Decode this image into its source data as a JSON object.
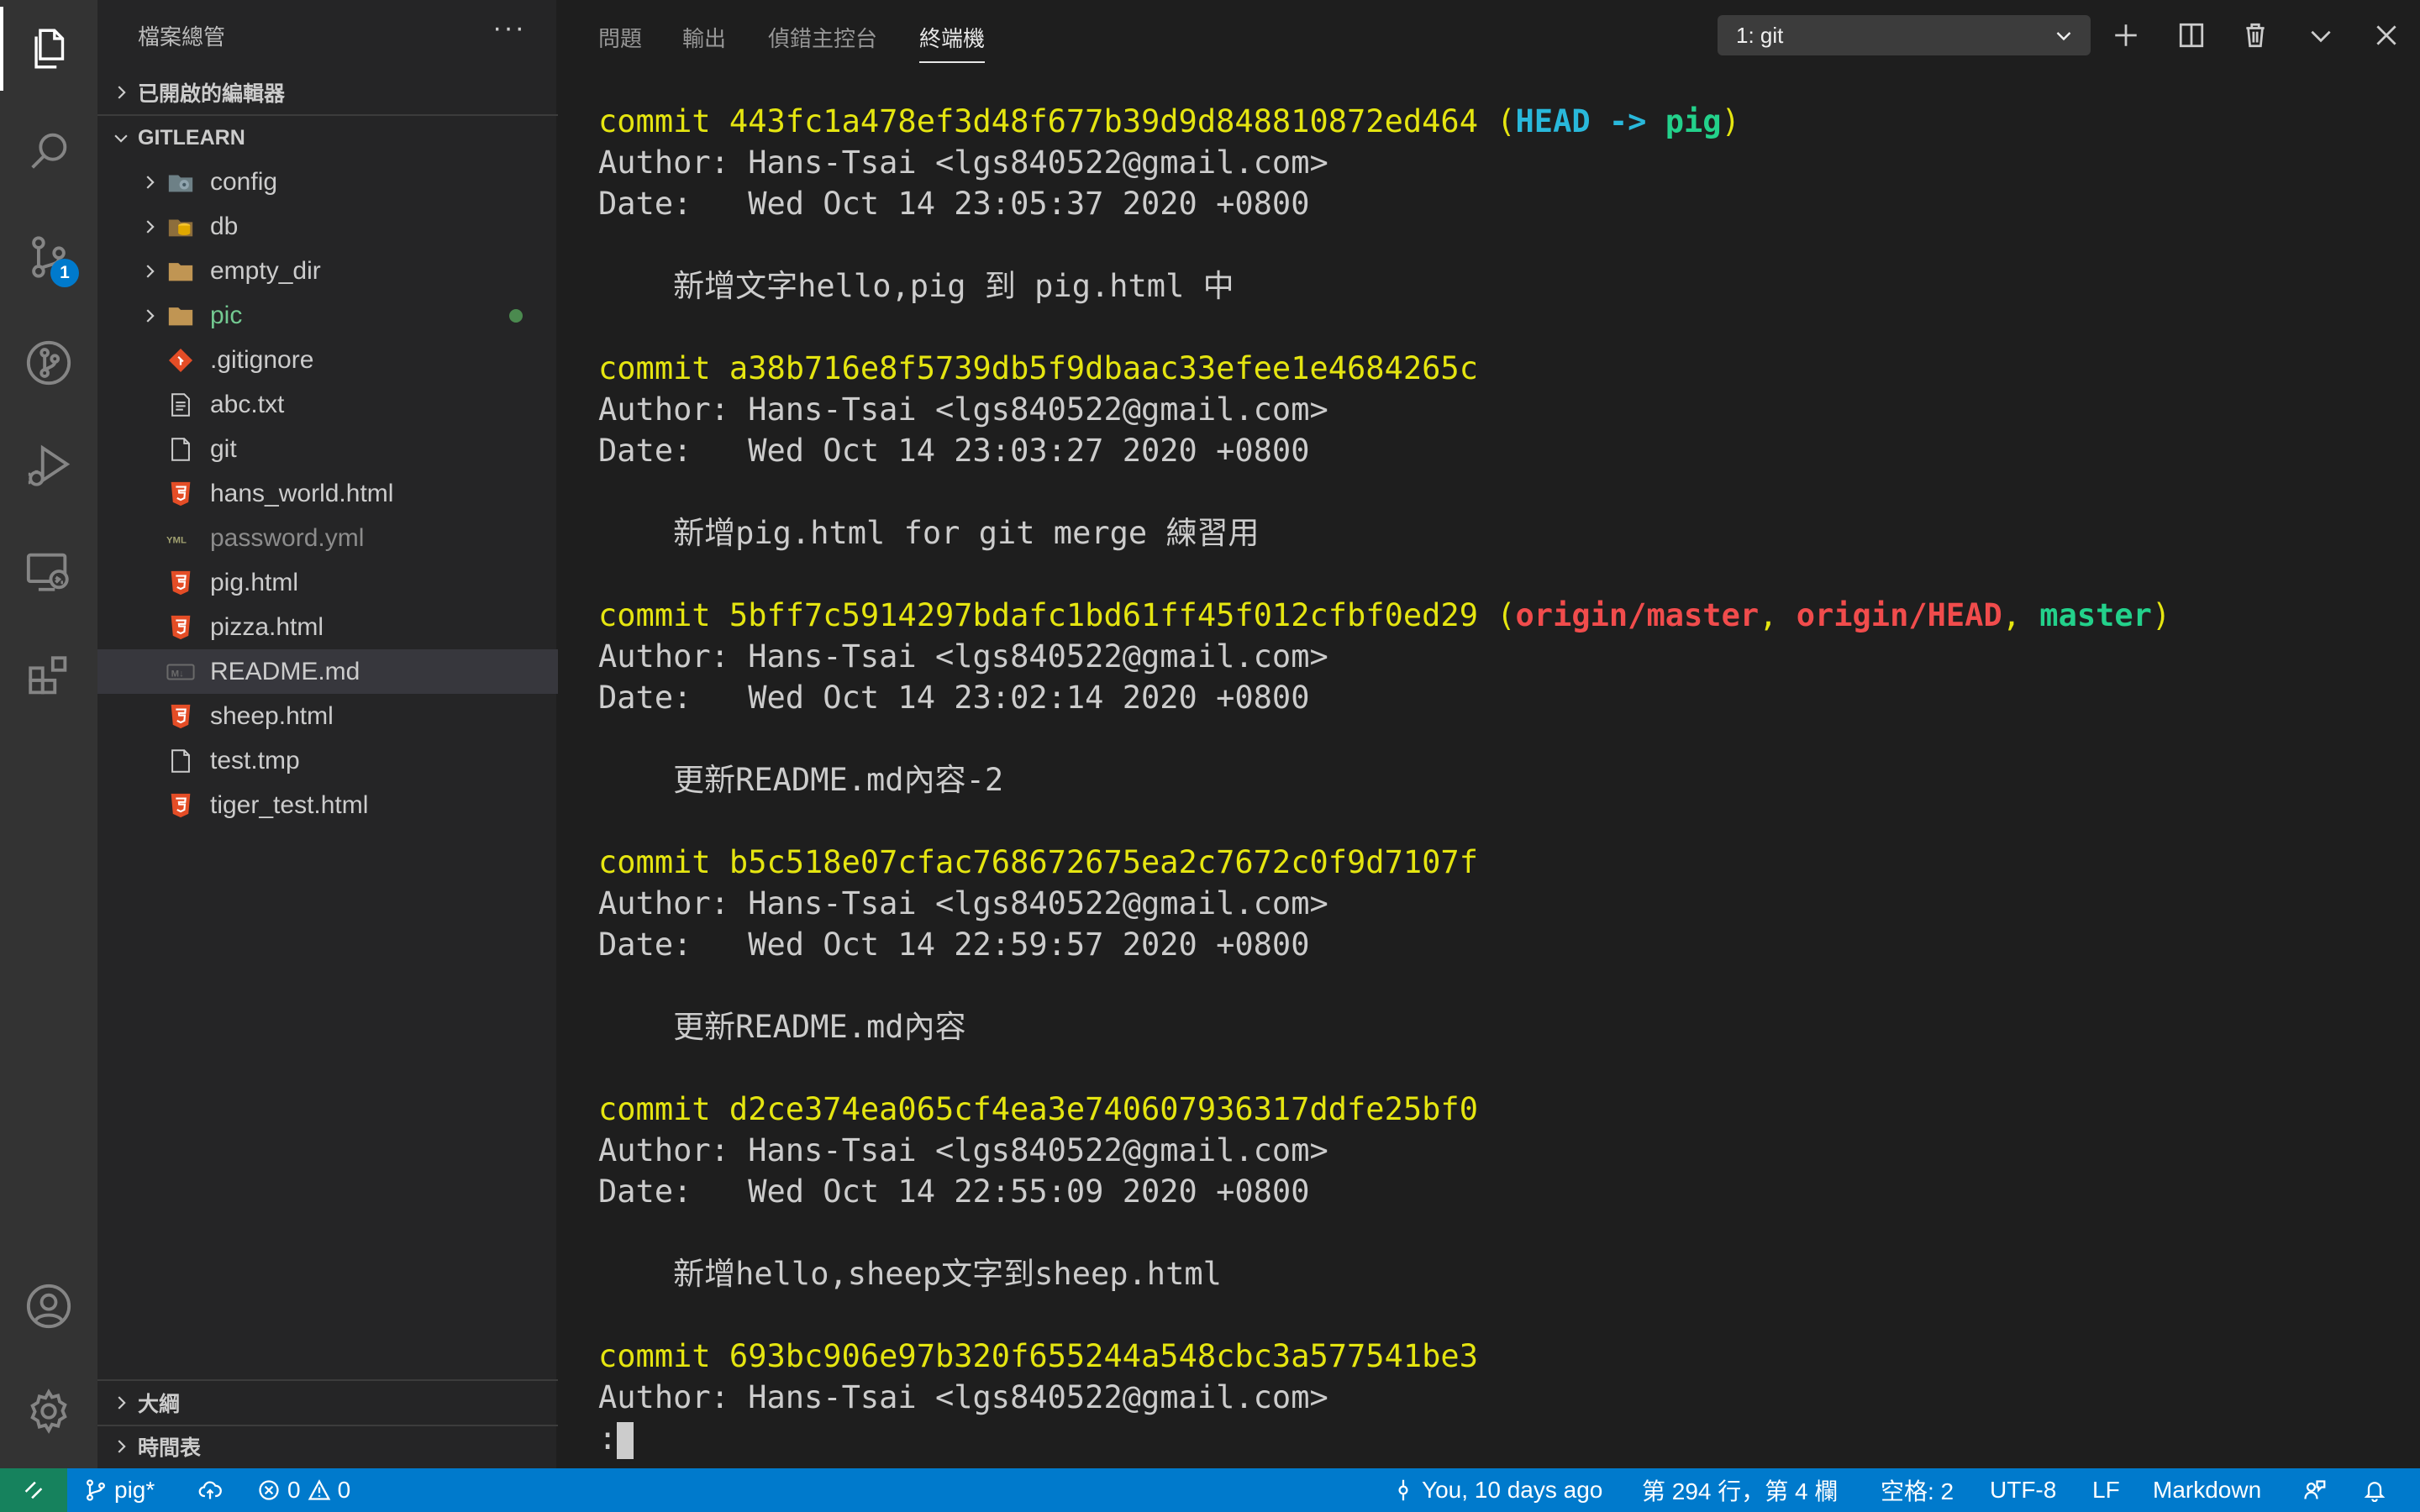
{
  "activity_bar": {
    "items": [
      {
        "icon": "files-icon",
        "active": true
      },
      {
        "icon": "search-icon"
      },
      {
        "icon": "source-control-icon",
        "badge": "1"
      },
      {
        "icon": "git-graph-icon"
      },
      {
        "icon": "run-debug-icon"
      },
      {
        "icon": "remote-explorer-icon"
      },
      {
        "icon": "extensions-icon"
      }
    ],
    "bottom_items": [
      {
        "icon": "account-icon"
      },
      {
        "icon": "settings-gear-icon"
      }
    ]
  },
  "sidebar": {
    "title": "檔案總管",
    "more_label": "···",
    "open_editors_label": "已開啟的編輯器",
    "folder_label": "GITLEARN",
    "files": [
      {
        "name": "config",
        "type": "folder",
        "icon": "config-folder-icon"
      },
      {
        "name": "db",
        "type": "folder",
        "icon": "database-folder-icon"
      },
      {
        "name": "empty_dir",
        "type": "folder",
        "icon": "folder-icon"
      },
      {
        "name": "pic",
        "type": "folder",
        "icon": "folder-icon",
        "modified": true
      },
      {
        "name": ".gitignore",
        "type": "file",
        "icon": "git-icon"
      },
      {
        "name": "abc.txt",
        "type": "file",
        "icon": "text-file-icon"
      },
      {
        "name": "git",
        "type": "file",
        "icon": "blank-file-icon"
      },
      {
        "name": "hans_world.html",
        "type": "file",
        "icon": "html5-icon"
      },
      {
        "name": "password.yml",
        "type": "file",
        "icon": "yaml-icon",
        "ignored": true
      },
      {
        "name": "pig.html",
        "type": "file",
        "icon": "html5-icon"
      },
      {
        "name": "pizza.html",
        "type": "file",
        "icon": "html5-icon"
      },
      {
        "name": "README.md",
        "type": "file",
        "icon": "markdown-icon",
        "selected": true
      },
      {
        "name": "sheep.html",
        "type": "file",
        "icon": "html5-icon"
      },
      {
        "name": "test.tmp",
        "type": "file",
        "icon": "blank-file-icon"
      },
      {
        "name": "tiger_test.html",
        "type": "file",
        "icon": "html5-icon"
      }
    ],
    "outline_label": "大綱",
    "timeline_label": "時間表"
  },
  "panel": {
    "tabs": [
      "問題",
      "輸出",
      "偵錯主控台",
      "終端機"
    ],
    "active_tab": "終端機",
    "terminal_select": "1: git"
  },
  "terminal": {
    "commits": [
      {
        "hash": "commit 443fc1a478ef3d48f677b39d9d848810872ed464",
        "refs": [
          {
            "text": "HEAD -> ",
            "color": "cyan"
          },
          {
            "text": "pig",
            "color": "green"
          }
        ],
        "author": "Author: Hans-Tsai <lgs840522@gmail.com>",
        "date": "Date:   Wed Oct 14 23:05:37 2020 +0800",
        "message": "    新增文字hello,pig 到 pig.html 中"
      },
      {
        "hash": "commit a38b716e8f5739db5f9dbaac33efee1e4684265c",
        "refs": [],
        "author": "Author: Hans-Tsai <lgs840522@gmail.com>",
        "date": "Date:   Wed Oct 14 23:03:27 2020 +0800",
        "message": "    新增pig.html for git merge 練習用"
      },
      {
        "hash": "commit 5bff7c5914297bdafc1bd61ff45f012cfbf0ed29",
        "refs": [
          {
            "text": "origin/master",
            "color": "red"
          },
          {
            "text": ", ",
            "color": "yellow"
          },
          {
            "text": "origin/HEAD",
            "color": "red"
          },
          {
            "text": ", ",
            "color": "yellow"
          },
          {
            "text": "master",
            "color": "green"
          }
        ],
        "author": "Author: Hans-Tsai <lgs840522@gmail.com>",
        "date": "Date:   Wed Oct 14 23:02:14 2020 +0800",
        "message": "    更新README.md內容-2"
      },
      {
        "hash": "commit b5c518e07cfac768672675ea2c7672c0f9d7107f",
        "refs": [],
        "author": "Author: Hans-Tsai <lgs840522@gmail.com>",
        "date": "Date:   Wed Oct 14 22:59:57 2020 +0800",
        "message": "    更新README.md內容"
      },
      {
        "hash": "commit d2ce374ea065cf4ea3e740607936317ddfe25bf0",
        "refs": [],
        "author": "Author: Hans-Tsai <lgs840522@gmail.com>",
        "date": "Date:   Wed Oct 14 22:55:09 2020 +0800",
        "message": "    新增hello,sheep文字到sheep.html"
      },
      {
        "hash": "commit 693bc906e97b320f655244a548cbc3a577541be3",
        "refs": [],
        "author": "Author: Hans-Tsai <lgs840522@gmail.com>",
        "date": null,
        "message": null
      }
    ],
    "prompt": ":"
  },
  "status_bar": {
    "branch": "pig*",
    "errors": "0",
    "warnings": "0",
    "blame": "You, 10 days ago",
    "position": "第 294 行，第 4 欄",
    "spaces": "空格: 2",
    "encoding": "UTF-8",
    "eol": "LF",
    "language": "Markdown"
  },
  "colors": {
    "accent": "#007acc",
    "remote": "#16825d",
    "terminal_yellow": "#e5e510",
    "terminal_cyan": "#29b8db",
    "terminal_green": "#23d18b",
    "terminal_red": "#f14c4c"
  }
}
